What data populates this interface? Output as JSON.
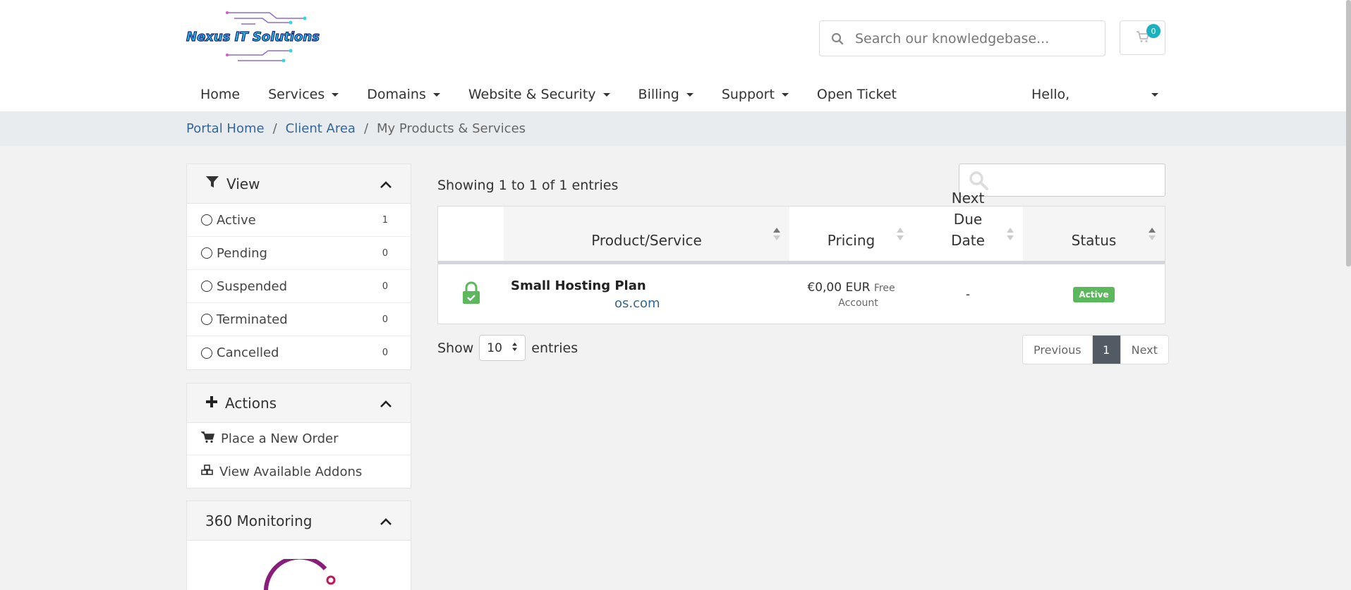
{
  "header": {
    "logo_text": "Nexus IT Solutions",
    "search_placeholder": "Search our knowledgebase...",
    "cart_count": "0",
    "nav": [
      {
        "label": "Home",
        "dropdown": false
      },
      {
        "label": "Services",
        "dropdown": true
      },
      {
        "label": "Domains",
        "dropdown": true
      },
      {
        "label": "Website & Security",
        "dropdown": true
      },
      {
        "label": "Billing",
        "dropdown": true
      },
      {
        "label": "Support",
        "dropdown": true
      },
      {
        "label": "Open Ticket",
        "dropdown": false
      }
    ],
    "greeting": "Hello,"
  },
  "breadcrumb": {
    "portal_home": "Portal Home",
    "client_area": "Client Area",
    "current": "My Products & Services",
    "sep": "/"
  },
  "view_panel": {
    "title": "View",
    "filters": [
      {
        "label": "Active",
        "count": "1"
      },
      {
        "label": "Pending",
        "count": "0"
      },
      {
        "label": "Suspended",
        "count": "0"
      },
      {
        "label": "Terminated",
        "count": "0"
      },
      {
        "label": "Cancelled",
        "count": "0"
      }
    ]
  },
  "actions_panel": {
    "title": "Actions",
    "items": [
      {
        "label": "Place a New Order",
        "icon": "cart-icon"
      },
      {
        "label": "View Available Addons",
        "icon": "cubes-icon"
      }
    ]
  },
  "monitoring_panel": {
    "title": "360 Monitoring"
  },
  "table": {
    "showing": "Showing 1 to 1 of 1 entries",
    "columns": [
      "Product/Service",
      "Pricing",
      "Next Due Date",
      "Status"
    ],
    "rows": [
      {
        "product": "Small Hosting Plan",
        "domain": "os.com",
        "price": "€0,00 EUR",
        "price_note_1": "Free",
        "price_note_2": "Account",
        "next_due": "-",
        "status": "Active"
      }
    ],
    "show_label": "Show",
    "page_size": "10",
    "entries_label": "entries",
    "pagination": {
      "previous": "Previous",
      "page": "1",
      "next": "Next"
    }
  },
  "colors": {
    "link": "#336699",
    "active_status": "#5cb85c",
    "cart_badge": "#1bb1bf",
    "page_active": "#525a64"
  }
}
